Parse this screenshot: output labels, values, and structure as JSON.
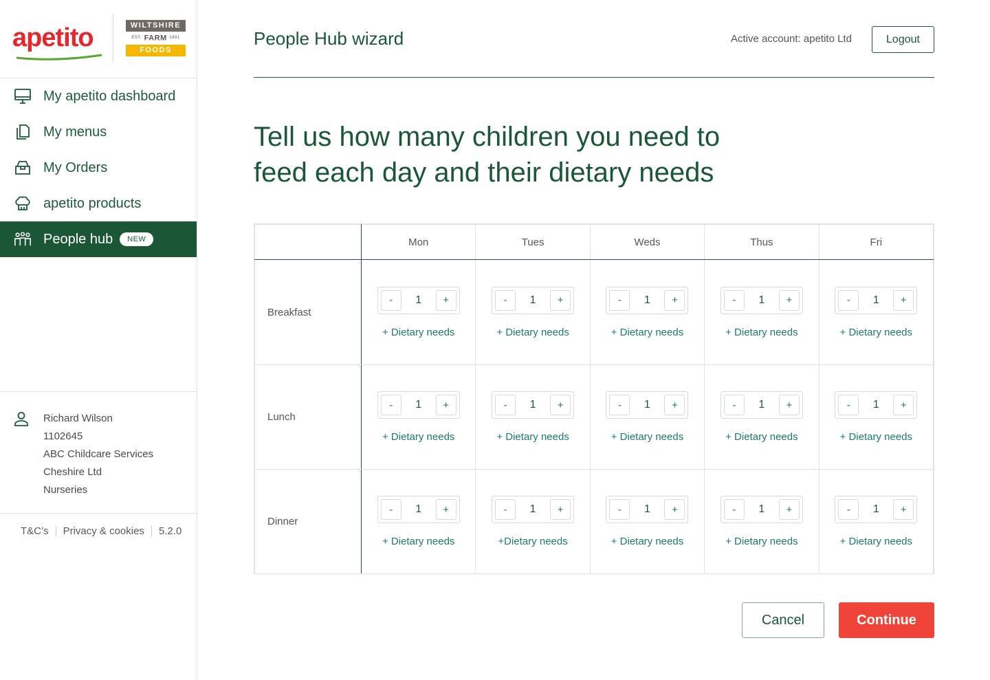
{
  "brand": {
    "logo_text": "apetito",
    "partner_top": "WILTSHIRE",
    "partner_est": "EST.",
    "partner_mid": "FARM",
    "partner_year": "1991",
    "partner_bottom": "FOODS",
    "colors": {
      "primary_green": "#1b5736",
      "brand_red": "#e5262b",
      "cta_red": "#f04438",
      "gold": "#f5b700"
    }
  },
  "sidebar": {
    "items": [
      {
        "label": "My apetito dashboard",
        "icon": "monitor-icon"
      },
      {
        "label": "My menus",
        "icon": "documents-icon"
      },
      {
        "label": "My Orders",
        "icon": "box-icon"
      },
      {
        "label": "apetito products",
        "icon": "chef-hat-icon"
      },
      {
        "label": "People hub",
        "icon": "people-icon",
        "badge": "NEW",
        "active": true
      }
    ],
    "user": {
      "lines": [
        "Richard Wilson",
        "1102645",
        "ABC Childcare Services",
        "Cheshire Ltd",
        "Nurseries"
      ]
    },
    "footer": {
      "terms": "T&C’s",
      "privacy": "Privacy & cookies",
      "version": "5.2.0"
    }
  },
  "header": {
    "title": "People Hub wizard",
    "active_account": "Active account: apetito Ltd",
    "logout_label": "Logout"
  },
  "main": {
    "heading": "Tell us how many children you need to feed each day and their dietary needs",
    "days": [
      "Mon",
      "Tues",
      "Weds",
      "Thus",
      "Fri"
    ],
    "meals": [
      {
        "name": "Breakfast",
        "cells": [
          {
            "value": "1",
            "link": "+ Dietary needs"
          },
          {
            "value": "1",
            "link": "+ Dietary needs"
          },
          {
            "value": "1",
            "link": "+ Dietary needs"
          },
          {
            "value": "1",
            "link": "+ Dietary needs"
          },
          {
            "value": "1",
            "link": "+ Dietary needs"
          }
        ]
      },
      {
        "name": "Lunch",
        "cells": [
          {
            "value": "1",
            "link": "+ Dietary needs"
          },
          {
            "value": "1",
            "link": "+ Dietary needs"
          },
          {
            "value": "1",
            "link": "+ Dietary needs"
          },
          {
            "value": "1",
            "link": "+ Dietary needs"
          },
          {
            "value": "1",
            "link": "+ Dietary needs"
          }
        ]
      },
      {
        "name": "Dinner",
        "cells": [
          {
            "value": "1",
            "link": "+ Dietary needs"
          },
          {
            "value": "1",
            "link": "+Dietary needs"
          },
          {
            "value": "1",
            "link": "+ Dietary needs"
          },
          {
            "value": "1",
            "link": "+ Dietary needs"
          },
          {
            "value": "1",
            "link": "+ Dietary needs"
          }
        ]
      }
    ],
    "stepper": {
      "minus": "-",
      "plus": "+"
    },
    "cancel_label": "Cancel",
    "continue_label": "Continue"
  }
}
